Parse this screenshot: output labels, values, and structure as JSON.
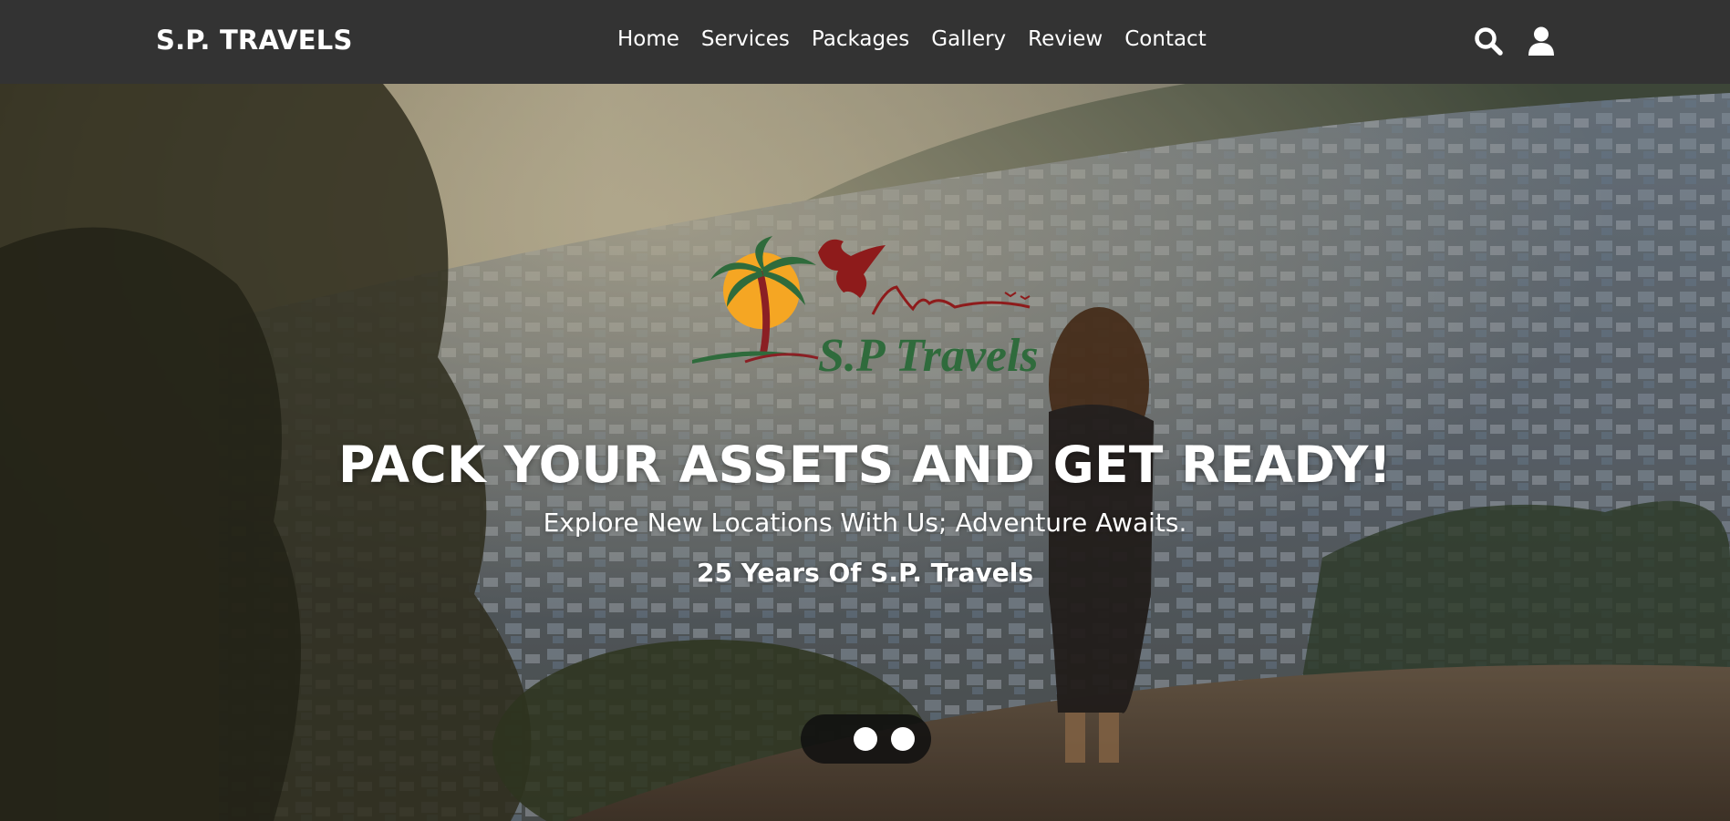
{
  "header": {
    "brand": "S.P. TRAVELS",
    "nav": [
      "Home",
      "Services",
      "Packages",
      "Gallery",
      "Review",
      "Contact"
    ],
    "icons": [
      "search-icon",
      "user-icon"
    ],
    "background_color": "#333333"
  },
  "hero": {
    "logo_text": "S.P Travels",
    "title": "PACK YOUR ASSETS AND GET READY!",
    "subtitle": "Explore New Locations With Us; Adventure Awaits.",
    "years": "25 Years Of S.P. Travels",
    "slider_dots": 2
  },
  "colors": {
    "logo_green": "#2f6b3c",
    "logo_red": "#8e1b1b",
    "logo_sun": "#f5a623",
    "text": "#ffffff"
  }
}
